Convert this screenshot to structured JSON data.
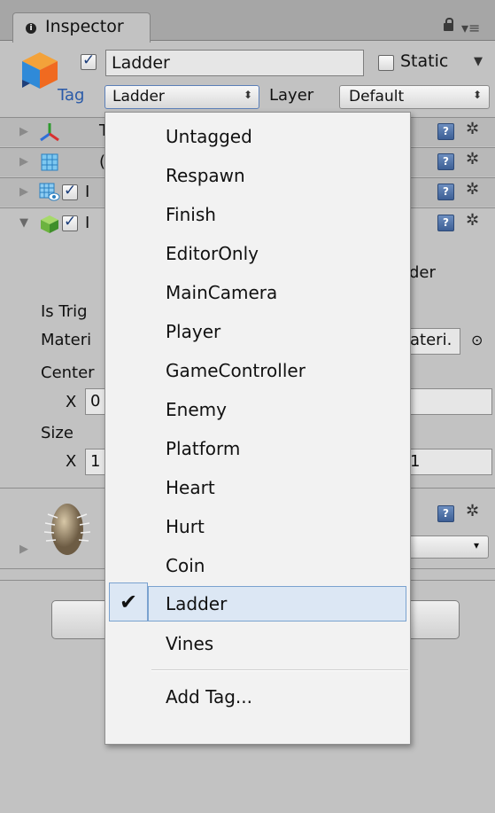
{
  "window": {
    "tab_label": "Inspector"
  },
  "header": {
    "object_name": "Ladder",
    "static_label": "Static",
    "tag_label": "Tag",
    "tag_value": "Ladder",
    "layer_label": "Layer",
    "layer_value": "Default"
  },
  "components": {
    "row1_letter": "T",
    "row2_letter": "(",
    "row3_letter": "I",
    "row4_letter": "I"
  },
  "body": {
    "collider_suffix": "der",
    "is_trigger_label": "Is Trig",
    "material_label": "Materi",
    "material_value": "ateri.",
    "center_label": "Center",
    "center_x_label": "X",
    "center_x_value": "0",
    "size_label": "Size",
    "size_x_label": "X",
    "size_x_value": "1",
    "size_z_value": "1"
  },
  "dropdown": {
    "items": [
      "Untagged",
      "Respawn",
      "Finish",
      "EditorOnly",
      "MainCamera",
      "Player",
      "GameController",
      "Enemy",
      "Platform",
      "Heart",
      "Hurt",
      "Coin",
      "Ladder",
      "Vines"
    ],
    "selected": "Ladder",
    "add_tag_label": "Add Tag..."
  }
}
